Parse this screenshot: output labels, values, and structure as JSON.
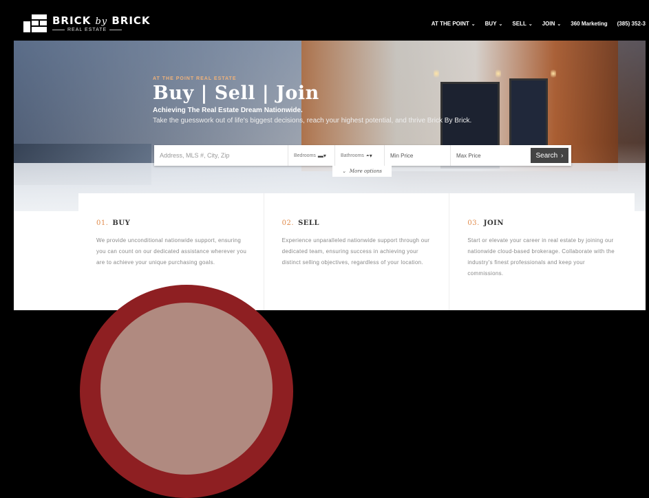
{
  "brand": {
    "name_part1": "BRICK",
    "name_by": "by",
    "name_part2": "BRICK",
    "sub": "REAL ESTATE"
  },
  "nav": {
    "items": [
      {
        "label": "AT THE POINT",
        "has_caret": true
      },
      {
        "label": "BUY",
        "has_caret": true
      },
      {
        "label": "SELL",
        "has_caret": true
      },
      {
        "label": "JOIN",
        "has_caret": true
      },
      {
        "label": "360 Marketing",
        "has_caret": false
      },
      {
        "label": "(385) 352-3",
        "has_caret": false
      }
    ]
  },
  "hero": {
    "eyebrow": "AT THE POINT REAL ESTATE",
    "title": "Buy | Sell | Join",
    "subtitle": "Achieving The Real Estate Dream Nationwide.",
    "tagline": "Take the guesswork out of life's biggest decisions, reach your highest potential, and thrive Brick By Brick."
  },
  "search": {
    "address_placeholder": "Address, MLS #, City, Zip",
    "bedrooms_label": "Bedrooms",
    "bathrooms_label": "Bathrooms",
    "min_price_placeholder": "Min Price",
    "max_price_placeholder": "Max Price",
    "button_label": "Search",
    "more_options": "More options"
  },
  "cards": [
    {
      "num": "01.",
      "title": "BUY",
      "body": "We provide unconditional nationwide support, ensuring you can count on our dedicated assistance wherever you are to achieve your unique purchasing goals."
    },
    {
      "num": "02.",
      "title": "SELL",
      "body": "Experience unparalleled nationwide support through our dedicated team, ensuring success in achieving your distinct selling objectives, regardless of your location."
    },
    {
      "num": "03.",
      "title": "JOIN",
      "body": "Start or elevate your career in real estate by joining our nationwide cloud-based brokerage. Collaborate with the industry's finest professionals and keep your commissions."
    }
  ],
  "colors": {
    "accent": "#e08a4a",
    "header_bg": "#000000",
    "search_button": "#444444",
    "circle": "#8e1f22"
  }
}
